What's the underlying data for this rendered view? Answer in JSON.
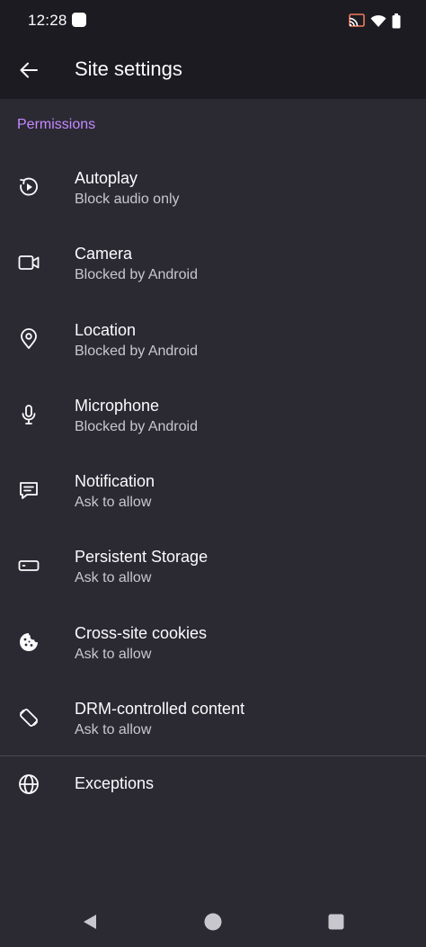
{
  "status_bar": {
    "time": "12:28"
  },
  "header": {
    "title": "Site settings",
    "back_icon": "arrow-left-icon"
  },
  "section": {
    "label": "Permissions",
    "accent_color": "#c689ff"
  },
  "permissions": [
    {
      "title": "Autoplay",
      "status": "Block audio only",
      "icon": "autoplay-icon"
    },
    {
      "title": "Camera",
      "status": "Blocked by Android",
      "icon": "camera-icon"
    },
    {
      "title": "Location",
      "status": "Blocked by Android",
      "icon": "location-pin-icon"
    },
    {
      "title": "Microphone",
      "status": "Blocked by Android",
      "icon": "microphone-icon"
    },
    {
      "title": "Notification",
      "status": "Ask to allow",
      "icon": "notification-icon"
    },
    {
      "title": "Persistent Storage",
      "status": "Ask to allow",
      "icon": "storage-icon"
    },
    {
      "title": "Cross-site cookies",
      "status": "Ask to allow",
      "icon": "cookie-icon"
    },
    {
      "title": "DRM-controlled content",
      "status": "Ask to allow",
      "icon": "drm-icon"
    }
  ],
  "exceptions": {
    "label": "Exceptions",
    "icon": "globe-icon"
  },
  "colors": {
    "background": "#2b2a33",
    "bar": "#1c1b22",
    "text_primary": "#fbfbfe",
    "text_secondary": "#c8c7cd"
  }
}
